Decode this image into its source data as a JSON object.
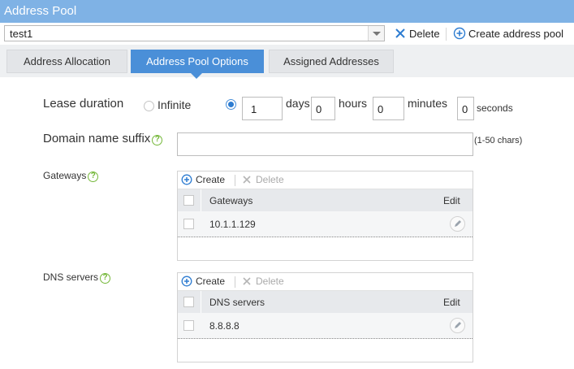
{
  "window": {
    "title": "Address Pool"
  },
  "pool_selector": {
    "value": "test1"
  },
  "toolbar": {
    "delete_label": "Delete",
    "create_label": "Create address pool"
  },
  "tabs": [
    {
      "label": "Address Allocation",
      "active": false
    },
    {
      "label": "Address Pool Options",
      "active": true
    },
    {
      "label": "Assigned Addresses",
      "active": false
    }
  ],
  "lease": {
    "label": "Lease duration",
    "infinite_label": "Infinite",
    "infinite_selected": false,
    "custom_selected": true,
    "days_value": "1",
    "days_unit": "days",
    "hours_value": "0",
    "hours_unit": "hours",
    "minutes_value": "0",
    "minutes_unit": "minutes",
    "seconds_value": "0",
    "seconds_unit": "seconds"
  },
  "domain": {
    "label": "Domain name suffix",
    "value": "",
    "hint": "(1-50 chars)"
  },
  "gateways": {
    "label": "Gateways",
    "create_label": "Create",
    "delete_label": "Delete",
    "columns": {
      "name": "Gateways",
      "edit": "Edit"
    },
    "rows": [
      {
        "value": "10.1.1.129"
      }
    ]
  },
  "dns": {
    "label": "DNS servers",
    "create_label": "Create",
    "delete_label": "Delete",
    "columns": {
      "name": "DNS servers",
      "edit": "Edit"
    },
    "rows": [
      {
        "value": "8.8.8.8"
      }
    ]
  },
  "colors": {
    "title_bar": "#7fb2e5",
    "active_tab": "#4a8fd8",
    "help_icon": "#75b83a",
    "create_icon": "#2d7cd1"
  },
  "icons": [
    "delete-x-icon",
    "add-circle-icon",
    "help-icon",
    "edit-pencil-icon",
    "chevron-down-icon"
  ]
}
